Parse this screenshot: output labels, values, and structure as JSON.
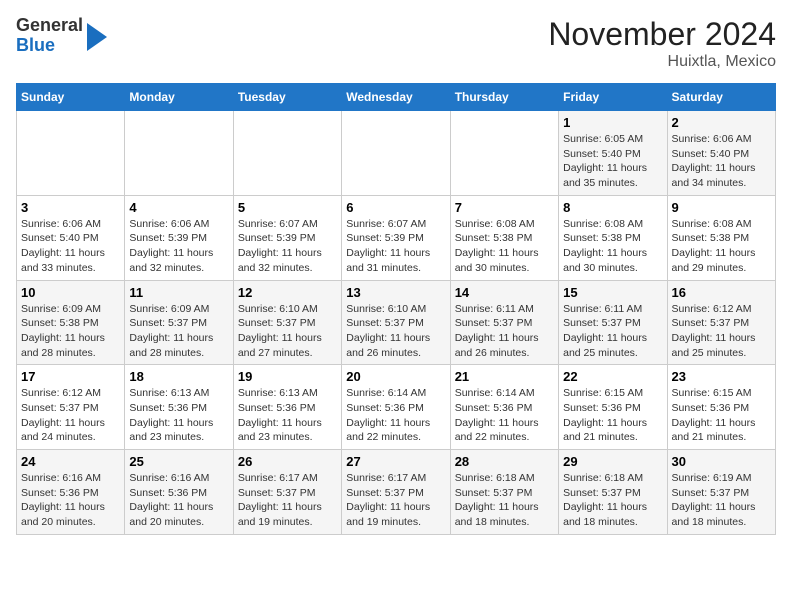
{
  "logo": {
    "line1": "General",
    "line2": "Blue"
  },
  "title": "November 2024",
  "subtitle": "Huixtla, Mexico",
  "days_of_week": [
    "Sunday",
    "Monday",
    "Tuesday",
    "Wednesday",
    "Thursday",
    "Friday",
    "Saturday"
  ],
  "weeks": [
    [
      {
        "day": "",
        "info": ""
      },
      {
        "day": "",
        "info": ""
      },
      {
        "day": "",
        "info": ""
      },
      {
        "day": "",
        "info": ""
      },
      {
        "day": "",
        "info": ""
      },
      {
        "day": "1",
        "info": "Sunrise: 6:05 AM\nSunset: 5:40 PM\nDaylight: 11 hours and 35 minutes."
      },
      {
        "day": "2",
        "info": "Sunrise: 6:06 AM\nSunset: 5:40 PM\nDaylight: 11 hours and 34 minutes."
      }
    ],
    [
      {
        "day": "3",
        "info": "Sunrise: 6:06 AM\nSunset: 5:40 PM\nDaylight: 11 hours and 33 minutes."
      },
      {
        "day": "4",
        "info": "Sunrise: 6:06 AM\nSunset: 5:39 PM\nDaylight: 11 hours and 32 minutes."
      },
      {
        "day": "5",
        "info": "Sunrise: 6:07 AM\nSunset: 5:39 PM\nDaylight: 11 hours and 32 minutes."
      },
      {
        "day": "6",
        "info": "Sunrise: 6:07 AM\nSunset: 5:39 PM\nDaylight: 11 hours and 31 minutes."
      },
      {
        "day": "7",
        "info": "Sunrise: 6:08 AM\nSunset: 5:38 PM\nDaylight: 11 hours and 30 minutes."
      },
      {
        "day": "8",
        "info": "Sunrise: 6:08 AM\nSunset: 5:38 PM\nDaylight: 11 hours and 30 minutes."
      },
      {
        "day": "9",
        "info": "Sunrise: 6:08 AM\nSunset: 5:38 PM\nDaylight: 11 hours and 29 minutes."
      }
    ],
    [
      {
        "day": "10",
        "info": "Sunrise: 6:09 AM\nSunset: 5:38 PM\nDaylight: 11 hours and 28 minutes."
      },
      {
        "day": "11",
        "info": "Sunrise: 6:09 AM\nSunset: 5:37 PM\nDaylight: 11 hours and 28 minutes."
      },
      {
        "day": "12",
        "info": "Sunrise: 6:10 AM\nSunset: 5:37 PM\nDaylight: 11 hours and 27 minutes."
      },
      {
        "day": "13",
        "info": "Sunrise: 6:10 AM\nSunset: 5:37 PM\nDaylight: 11 hours and 26 minutes."
      },
      {
        "day": "14",
        "info": "Sunrise: 6:11 AM\nSunset: 5:37 PM\nDaylight: 11 hours and 26 minutes."
      },
      {
        "day": "15",
        "info": "Sunrise: 6:11 AM\nSunset: 5:37 PM\nDaylight: 11 hours and 25 minutes."
      },
      {
        "day": "16",
        "info": "Sunrise: 6:12 AM\nSunset: 5:37 PM\nDaylight: 11 hours and 25 minutes."
      }
    ],
    [
      {
        "day": "17",
        "info": "Sunrise: 6:12 AM\nSunset: 5:37 PM\nDaylight: 11 hours and 24 minutes."
      },
      {
        "day": "18",
        "info": "Sunrise: 6:13 AM\nSunset: 5:36 PM\nDaylight: 11 hours and 23 minutes."
      },
      {
        "day": "19",
        "info": "Sunrise: 6:13 AM\nSunset: 5:36 PM\nDaylight: 11 hours and 23 minutes."
      },
      {
        "day": "20",
        "info": "Sunrise: 6:14 AM\nSunset: 5:36 PM\nDaylight: 11 hours and 22 minutes."
      },
      {
        "day": "21",
        "info": "Sunrise: 6:14 AM\nSunset: 5:36 PM\nDaylight: 11 hours and 22 minutes."
      },
      {
        "day": "22",
        "info": "Sunrise: 6:15 AM\nSunset: 5:36 PM\nDaylight: 11 hours and 21 minutes."
      },
      {
        "day": "23",
        "info": "Sunrise: 6:15 AM\nSunset: 5:36 PM\nDaylight: 11 hours and 21 minutes."
      }
    ],
    [
      {
        "day": "24",
        "info": "Sunrise: 6:16 AM\nSunset: 5:36 PM\nDaylight: 11 hours and 20 minutes."
      },
      {
        "day": "25",
        "info": "Sunrise: 6:16 AM\nSunset: 5:36 PM\nDaylight: 11 hours and 20 minutes."
      },
      {
        "day": "26",
        "info": "Sunrise: 6:17 AM\nSunset: 5:37 PM\nDaylight: 11 hours and 19 minutes."
      },
      {
        "day": "27",
        "info": "Sunrise: 6:17 AM\nSunset: 5:37 PM\nDaylight: 11 hours and 19 minutes."
      },
      {
        "day": "28",
        "info": "Sunrise: 6:18 AM\nSunset: 5:37 PM\nDaylight: 11 hours and 18 minutes."
      },
      {
        "day": "29",
        "info": "Sunrise: 6:18 AM\nSunset: 5:37 PM\nDaylight: 11 hours and 18 minutes."
      },
      {
        "day": "30",
        "info": "Sunrise: 6:19 AM\nSunset: 5:37 PM\nDaylight: 11 hours and 18 minutes."
      }
    ]
  ]
}
